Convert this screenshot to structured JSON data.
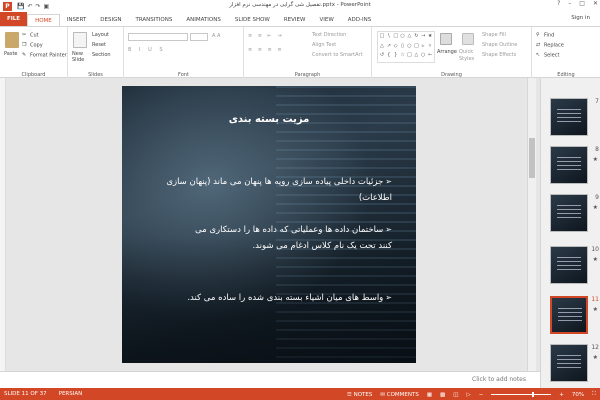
{
  "window": {
    "title": "تفصیل شی گرایی در مهندسی نرم افزار.pptx - PowerPoint",
    "app_icon": "P",
    "qat": [
      "save-icon",
      "undo-icon",
      "redo-icon",
      "slideshow-icon"
    ],
    "controls": [
      "?",
      "–",
      "□",
      "✕"
    ]
  },
  "tabs": [
    "FILE",
    "HOME",
    "INSERT",
    "DESIGN",
    "TRANSITIONS",
    "ANIMATIONS",
    "SLIDE SHOW",
    "REVIEW",
    "VIEW",
    "ADD-INS"
  ],
  "active_tab": "HOME",
  "signin": "Sign in",
  "ribbon": {
    "clipboard": {
      "paste": "Paste",
      "cut": "Cut",
      "copy": "Copy",
      "format_painter": "Format Painter",
      "label": "Clipboard"
    },
    "slides": {
      "new_slide": "New Slide",
      "layout": "Layout",
      "reset": "Reset",
      "section": "Section",
      "label": "Slides"
    },
    "font": {
      "label": "Font"
    },
    "paragraph": {
      "text_direction": "Text Direction",
      "align_text": "Align Text",
      "convert": "Convert to SmartArt",
      "label": "Paragraph"
    },
    "drawing": {
      "arrange": "Arrange",
      "quick_styles": "Quick Styles",
      "shape_fill": "Shape Fill",
      "shape_outline": "Shape Outline",
      "shape_effects": "Shape Effects",
      "label": "Drawing"
    },
    "editing": {
      "find": "Find",
      "replace": "Replace",
      "select": "Select",
      "label": "Editing"
    }
  },
  "slide": {
    "title": "مزیت بسته بندی",
    "bullets": [
      "جزئیات داخلی پیاده سازی رویه ها پنهان می ماند (پنهان سازی اطلاعات)",
      "ساختمان داده ها وعملیاتی که داده ها را دستکاری می کنند تحت یک نام کلاس ادغام می شوند.",
      "واسط های میان اشیاء بسته بندی شده را ساده می کند."
    ],
    "bullet_marker": "➢"
  },
  "notes_placeholder": "Click to add notes",
  "thumbnails": [
    {
      "num": "7",
      "star": ""
    },
    {
      "num": "8",
      "star": "★"
    },
    {
      "num": "9",
      "star": "★"
    },
    {
      "num": "10",
      "star": "★"
    },
    {
      "num": "11",
      "star": "★"
    },
    {
      "num": "12",
      "star": "★"
    }
  ],
  "selected_thumbnail": "11",
  "status": {
    "slide_info": "SLIDE 11 OF 37",
    "language": "PERSIAN",
    "notes": "NOTES",
    "comments": "COMMENTS",
    "zoom": "70%",
    "accent": "#d24726"
  }
}
